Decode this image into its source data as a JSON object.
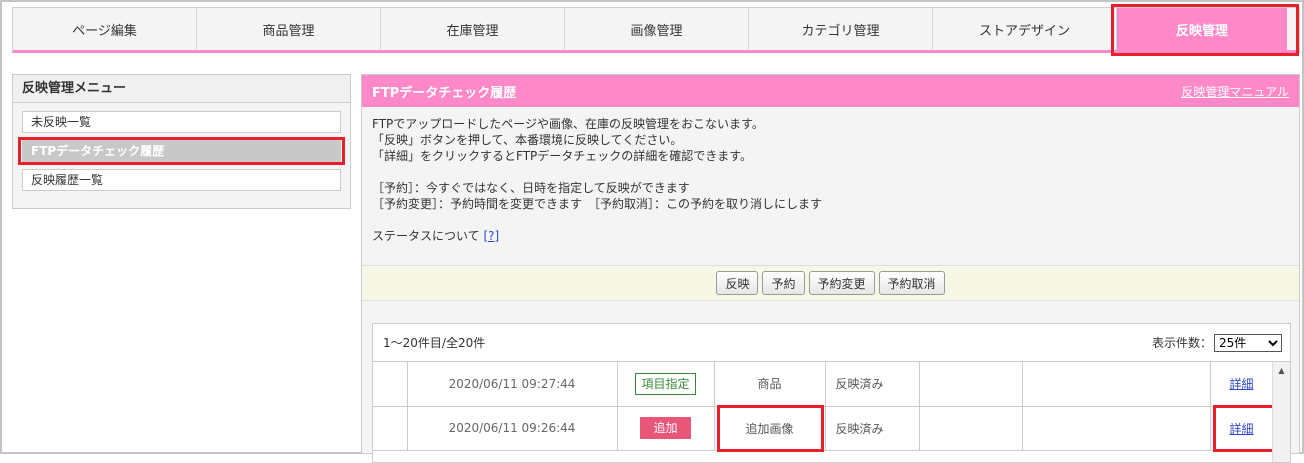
{
  "tabs": [
    {
      "label": "ページ編集"
    },
    {
      "label": "商品管理"
    },
    {
      "label": "在庫管理"
    },
    {
      "label": "画像管理"
    },
    {
      "label": "カテゴリ管理"
    },
    {
      "label": "ストアデザイン"
    },
    {
      "label": "反映管理",
      "active": true
    }
  ],
  "sidebar": {
    "title": "反映管理メニュー",
    "items": [
      {
        "label": "未反映一覧"
      },
      {
        "label": "FTPデータチェック履歴",
        "active": true
      },
      {
        "label": "反映履歴一覧"
      }
    ]
  },
  "main": {
    "title": "FTPデータチェック履歴",
    "manual_link": "反映管理マニュアル",
    "description": [
      "FTPでアップロードしたページや画像、在庫の反映管理をおこないます。",
      "「反映」ボタンを押して、本番環境に反映してください。",
      "「詳細」をクリックするとFTPデータチェックの詳細を確認できます。"
    ],
    "notes": [
      "［予約］：今すぐではなく、日時を指定して反映ができます",
      "［予約変更］：予約時間を変更できます　［予約取消］：この予約を取り消しにします"
    ],
    "status_text": "ステータスについて",
    "status_help": "[?]",
    "buttons": {
      "reflect": "反映",
      "reserve": "予約",
      "change": "予約変更",
      "cancel": "予約取消"
    }
  },
  "list": {
    "count_text": "1～20件目/全20件",
    "per_page_label": "表示件数：",
    "per_page_value": "25件",
    "rows": [
      {
        "timestamp": "2020/06/11 09:27:44",
        "badge": "項目指定",
        "badge_style": "outline",
        "type": "商品",
        "status": "反映済み",
        "detail": "詳細"
      },
      {
        "timestamp": "2020/06/11 09:26:44",
        "badge": "追加",
        "badge_style": "solid",
        "type": "追加画像",
        "status": "反映済み",
        "detail": "詳細"
      }
    ]
  },
  "colors": {
    "accent_pink": "#ff88c8",
    "highlight_red": "#e8202a",
    "badge_pink": "#e8577a",
    "badge_green": "#3a8a3a",
    "link_blue": "#2f48c8"
  }
}
